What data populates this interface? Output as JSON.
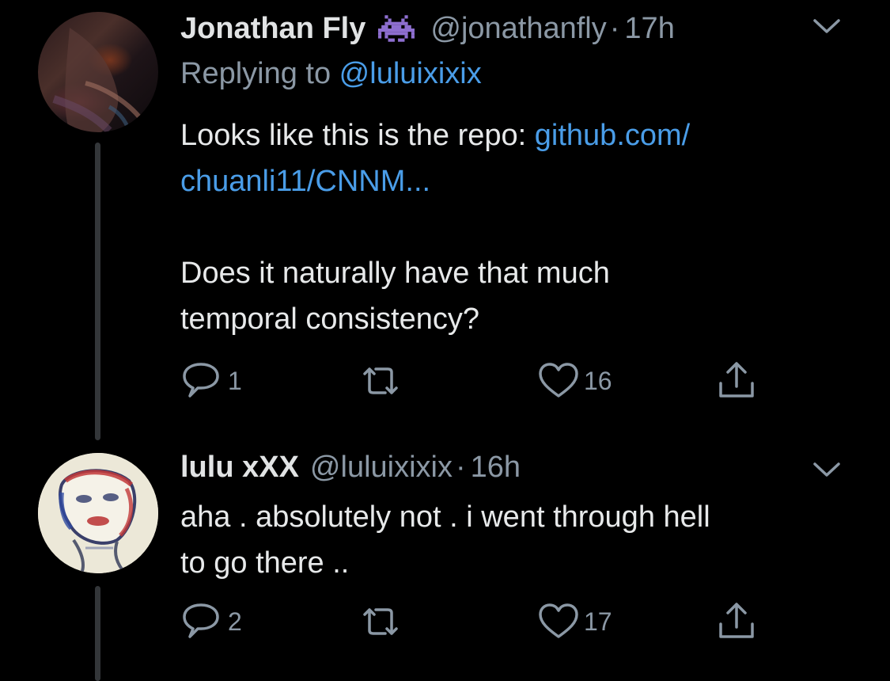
{
  "tweets": [
    {
      "display_name": "Jonathan Fly",
      "name_emoji": "alien-monster-emoji",
      "handle": "@jonathanfly",
      "separator": "·",
      "time": "17h",
      "replying_prefix": "Replying to ",
      "replying_to": "@luluixixix",
      "body": {
        "line1_text": "Looks like this is the repo: ",
        "line1_link": "github.com/",
        "line2_link": "chuanli11/CNNM...",
        "line3": "Does it naturally have that much",
        "line4": "temporal consistency?"
      },
      "actions": {
        "replies": "1",
        "retweets": "",
        "likes": "16"
      }
    },
    {
      "display_name": "lulu xXX",
      "handle": "@luluixixix",
      "separator": "·",
      "time": "16h",
      "body": {
        "line1": "aha . absolutely not . i went through hell",
        "line2": "to go there .."
      },
      "actions": {
        "replies": "2",
        "retweets": "",
        "likes": "17"
      }
    }
  ],
  "icons": {
    "reply": "reply-icon",
    "retweet": "retweet-icon",
    "like": "heart-icon",
    "share": "share-icon",
    "more": "chevron-down-icon"
  },
  "colors": {
    "background": "#000000",
    "text": "#e7e9ea",
    "muted": "#8b98a5",
    "link": "#4a9de8",
    "thread_line": "#333639"
  }
}
